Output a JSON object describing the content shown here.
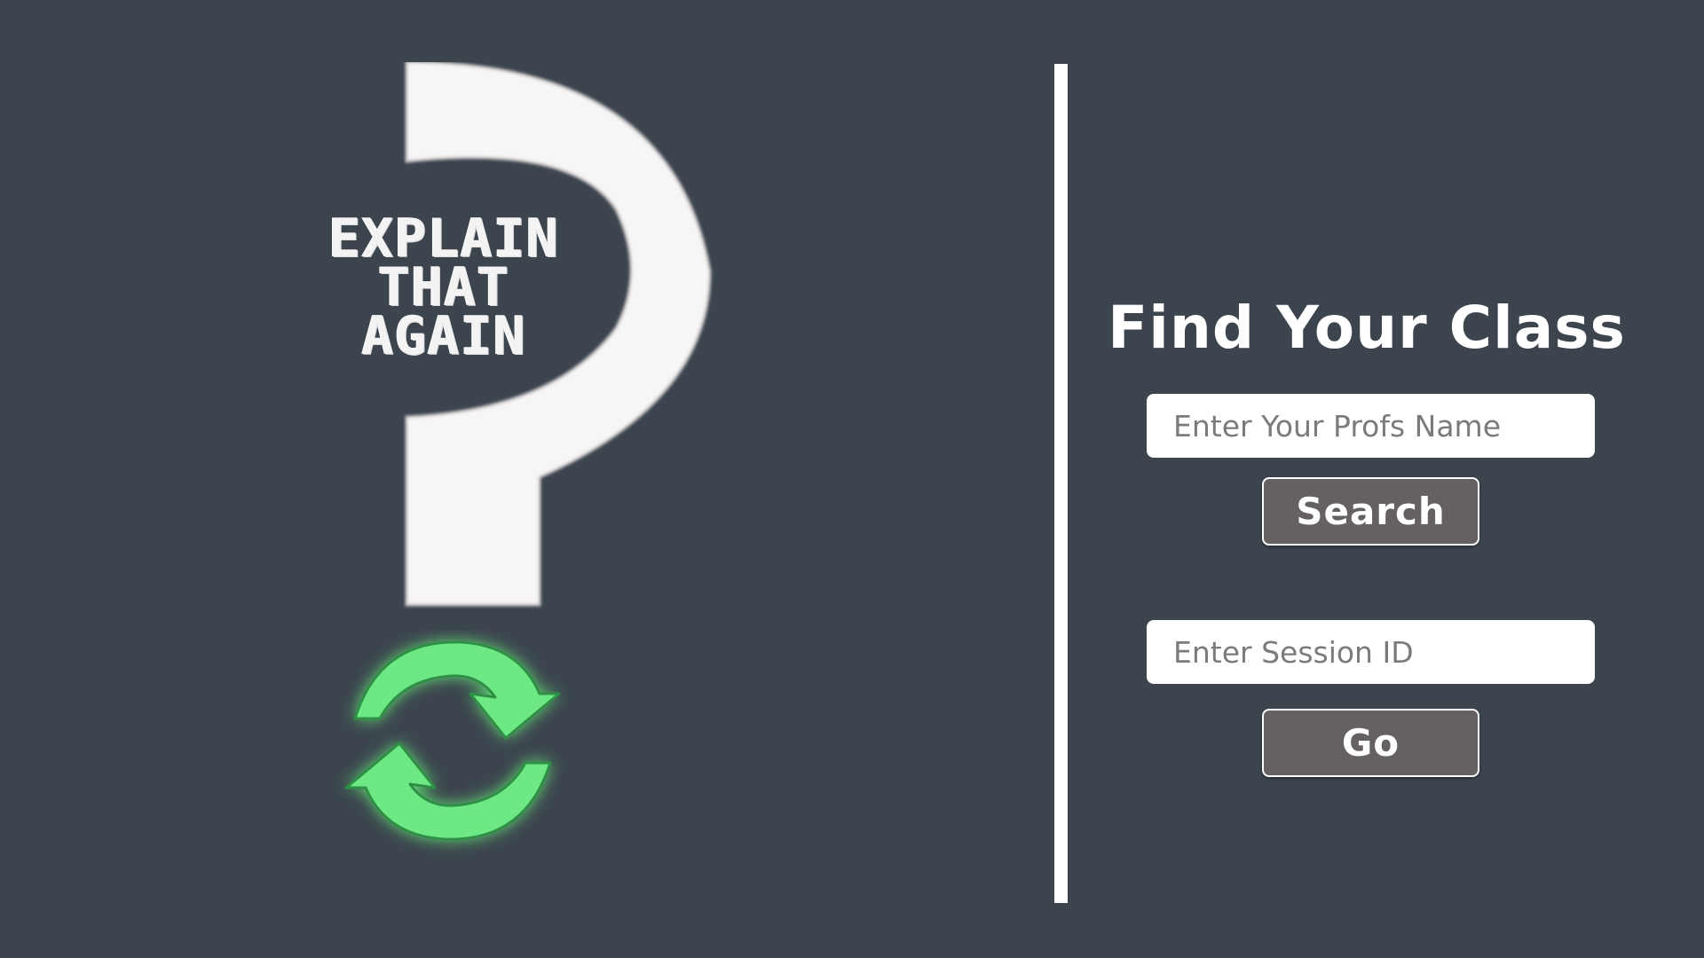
{
  "logo": {
    "line1": "EXPLAIN",
    "line2": "THAT",
    "line3": "AGAIN",
    "mark_icon": "question-mark-icon",
    "refresh_icon": "refresh-arrows-icon",
    "refresh_color": "#6ee884"
  },
  "finder": {
    "title": "Find Your Class",
    "prof_placeholder": "Enter Your Profs Name",
    "search_label": "Search",
    "session_placeholder": "Enter Session ID",
    "go_label": "Go"
  },
  "colors": {
    "background": "#3c444e",
    "button_fill": "#656061",
    "divider": "#ffffff"
  }
}
